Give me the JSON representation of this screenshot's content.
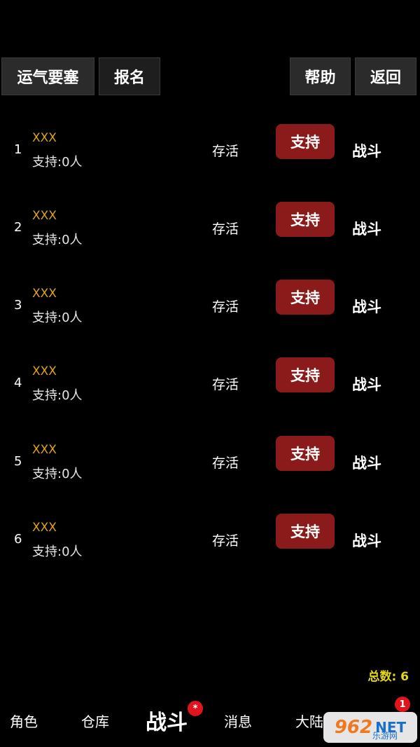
{
  "top_buttons": [
    {
      "label": "运气要塞"
    },
    {
      "label": "报名"
    },
    {
      "label": "帮助"
    },
    {
      "label": "返回"
    }
  ],
  "rows": [
    {
      "rank": "1",
      "name": "XXX",
      "support": "支持:0人",
      "status": "存活",
      "support_btn": "支持",
      "fight": "战斗"
    },
    {
      "rank": "2",
      "name": "XXX",
      "support": "支持:0人",
      "status": "存活",
      "support_btn": "支持",
      "fight": "战斗"
    },
    {
      "rank": "3",
      "name": "XXX",
      "support": "支持:0人",
      "status": "存活",
      "support_btn": "支持",
      "fight": "战斗"
    },
    {
      "rank": "4",
      "name": "XXX",
      "support": "支持:0人",
      "status": "存活",
      "support_btn": "支持",
      "fight": "战斗"
    },
    {
      "rank": "5",
      "name": "XXX",
      "support": "支持:0人",
      "status": "存活",
      "support_btn": "支持",
      "fight": "战斗"
    },
    {
      "rank": "6",
      "name": "XXX",
      "support": "支持:0人",
      "status": "存活",
      "support_btn": "支持",
      "fight": "战斗"
    }
  ],
  "total_label": "总数: 6",
  "tabs": [
    {
      "label": "角色"
    },
    {
      "label": "仓库"
    },
    {
      "label": "战斗",
      "badge": "*"
    },
    {
      "label": "消息"
    },
    {
      "label": "大陆"
    },
    {
      "label": "",
      "badge": "1"
    }
  ],
  "watermark": {
    "num": "962",
    "net": "NET",
    "cn": "乐游网"
  },
  "colors": {
    "accent_gold": "#e0a21a",
    "support_button": "#8b1a1a",
    "total_yellow": "#e3d71a",
    "badge_red": "#e0141d"
  }
}
